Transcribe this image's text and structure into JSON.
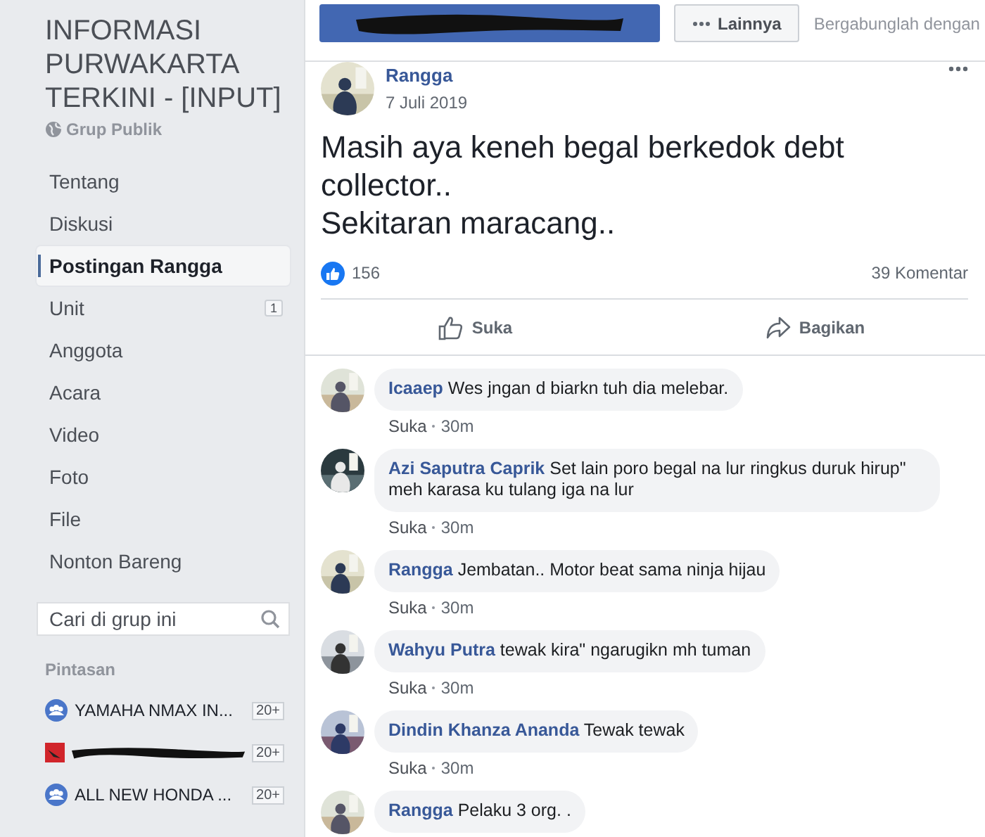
{
  "group": {
    "title": "INFORMASI PURWAKARTA TERKINI - [INPUT]",
    "privacy": "Grup Publik"
  },
  "nav": [
    {
      "label": "Tentang",
      "selected": false
    },
    {
      "label": "Diskusi",
      "selected": false
    },
    {
      "label": "Postingan Rangga",
      "selected": true
    },
    {
      "label": "Unit",
      "selected": false,
      "badge": "1"
    },
    {
      "label": "Anggota",
      "selected": false
    },
    {
      "label": "Acara",
      "selected": false
    },
    {
      "label": "Video",
      "selected": false
    },
    {
      "label": "Foto",
      "selected": false
    },
    {
      "label": "File",
      "selected": false
    },
    {
      "label": "Nonton Bareng",
      "selected": false
    }
  ],
  "search": {
    "placeholder": "Cari di grup ini"
  },
  "shortcuts": {
    "heading": "Pintasan",
    "items": [
      {
        "kind": "group",
        "label": "YAMAHA NMAX IN...",
        "badge": "20+"
      },
      {
        "kind": "redacted",
        "badge": "20+"
      },
      {
        "kind": "group",
        "label": "ALL NEW HONDA ...",
        "badge": "20+"
      }
    ]
  },
  "toolbar": {
    "more_button": "Lainnya",
    "join_text": "Bergabunglah dengan"
  },
  "post": {
    "author": "Rangga",
    "date": "7 Juli 2019",
    "text": "Masih aya keneh begal berkedok debt collector..\nSekitaran maracang..",
    "reactions": "156",
    "comments_count": "39 Komentar",
    "actions": [
      {
        "kind": "like",
        "label": "Suka"
      },
      {
        "kind": "share",
        "label": "Bagikan"
      }
    ]
  },
  "comments": [
    {
      "author": "Icaaep",
      "text": "Wes jngan d biarkn tuh dia melebar.",
      "like": "Suka",
      "time": "30m"
    },
    {
      "author": "Azi Saputra Caprik",
      "text": "Set lain poro begal na lur ringkus duruk hirup\" meh karasa ku tulang iga na lur",
      "like": "Suka",
      "time": "30m"
    },
    {
      "author": "Rangga",
      "text": "Jembatan.. Motor beat sama ninja hijau",
      "like": "Suka",
      "time": "30m"
    },
    {
      "author": "Wahyu Putra",
      "text": "tewak kira\" ngarugikn mh tuman",
      "like": "Suka",
      "time": "30m"
    },
    {
      "author": "Dindin Khanza Ananda",
      "text": "Tewak tewak",
      "like": "Suka",
      "time": "30m"
    },
    {
      "author": "Rangga",
      "text": "Pelaku 3 org. ."
    }
  ]
}
